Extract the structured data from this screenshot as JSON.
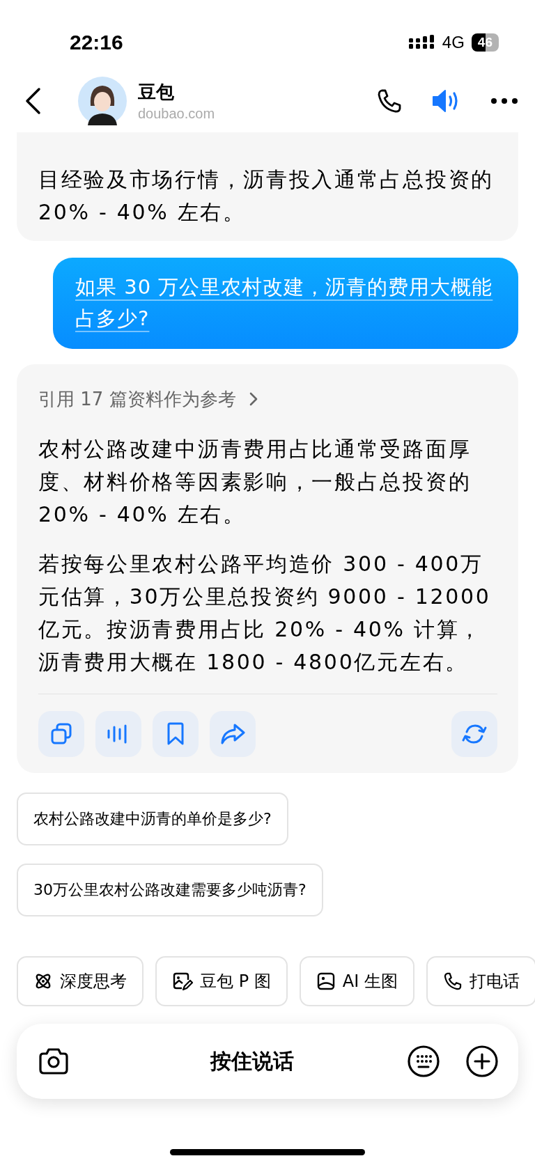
{
  "status_bar": {
    "time": "22:16",
    "network": "4G",
    "battery": "46"
  },
  "header": {
    "name": "豆包",
    "domain": "doubao.com"
  },
  "messages": [
    {
      "kind": "assistant",
      "paragraphs": [
        "目经验及市场行情，沥青投入通常占总投资的 20% - 40% 左右。"
      ],
      "show_actions": false
    },
    {
      "kind": "user",
      "text": "如果 30 万公里农村改建，沥青的费用大概能占多少?"
    },
    {
      "kind": "assistant",
      "reference": "引用 17 篇资料作为参考",
      "paragraphs": [
        "农村公路改建中沥青费用占比通常受路面厚度、材料价格等因素影响，一般占总投资的 20% - 40% 左右。",
        "若按每公里农村公路平均造价 300 - 400万元估算，30万公里总投资约 9000 - 12000亿元。按沥青费用占比 20% - 40% 计算，沥青费用大概在 1800 - 4800亿元左右。"
      ],
      "show_actions": true
    }
  ],
  "suggestions": [
    "农村公路改建中沥青的单价是多少?",
    "30万公里农村公路改建需要多少吨沥青?"
  ],
  "tools": [
    {
      "kind": "think",
      "label": "深度思考"
    },
    {
      "kind": "edit_image",
      "label": "豆包 P 图"
    },
    {
      "kind": "image",
      "label": "AI 生图"
    },
    {
      "kind": "call",
      "label": "打电话"
    }
  ],
  "input": {
    "label": "按住说话"
  }
}
